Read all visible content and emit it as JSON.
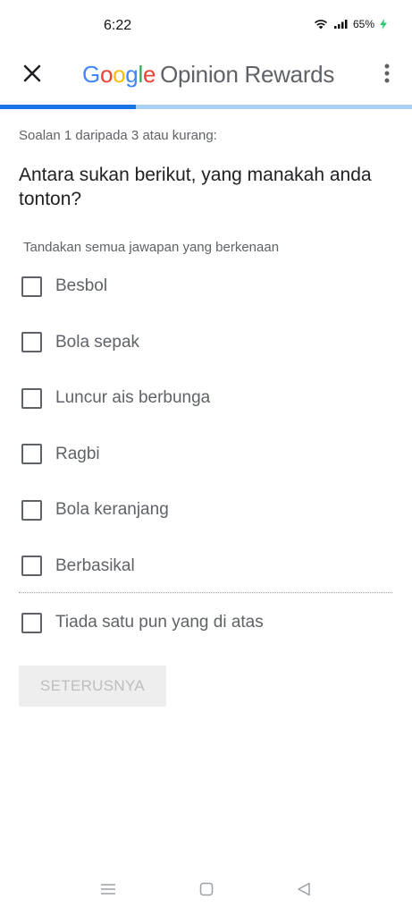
{
  "status_bar": {
    "time": "6:22",
    "battery": "65%",
    "icons": [
      "wifi-icon",
      "signal-icon",
      "battery-charging-icon"
    ]
  },
  "app_bar": {
    "title_brand": [
      "G",
      "o",
      "o",
      "g",
      "l",
      "e"
    ],
    "title_product": "Opinion Rewards",
    "close_icon": "close-icon",
    "menu_icon": "more-vert-icon"
  },
  "progress": {
    "fraction": 0.33
  },
  "question": {
    "counter": "Soalan 1 daripada 3 atau kurang:",
    "text": "Antara sukan berikut, yang manakah anda tonton?",
    "instruction": "Tandakan semua jawapan yang berkenaan"
  },
  "options": [
    "Besbol",
    "Bola sepak",
    "Luncur ais berbunga",
    "Ragbi",
    "Bola keranjang",
    "Berbasikal",
    "Tiada satu pun yang di atas"
  ],
  "next_button": {
    "label": "SETERUSNYA"
  },
  "colors": {
    "accent": "#1a73e8",
    "progress_track": "#a8d1f3",
    "google_blue": "#4285F4",
    "google_red": "#EA4335",
    "google_yellow": "#FBBC05",
    "google_green": "#34A853"
  },
  "nav_bar": {
    "icons": [
      "menu-nav-icon",
      "home-nav-icon",
      "back-nav-icon"
    ]
  }
}
